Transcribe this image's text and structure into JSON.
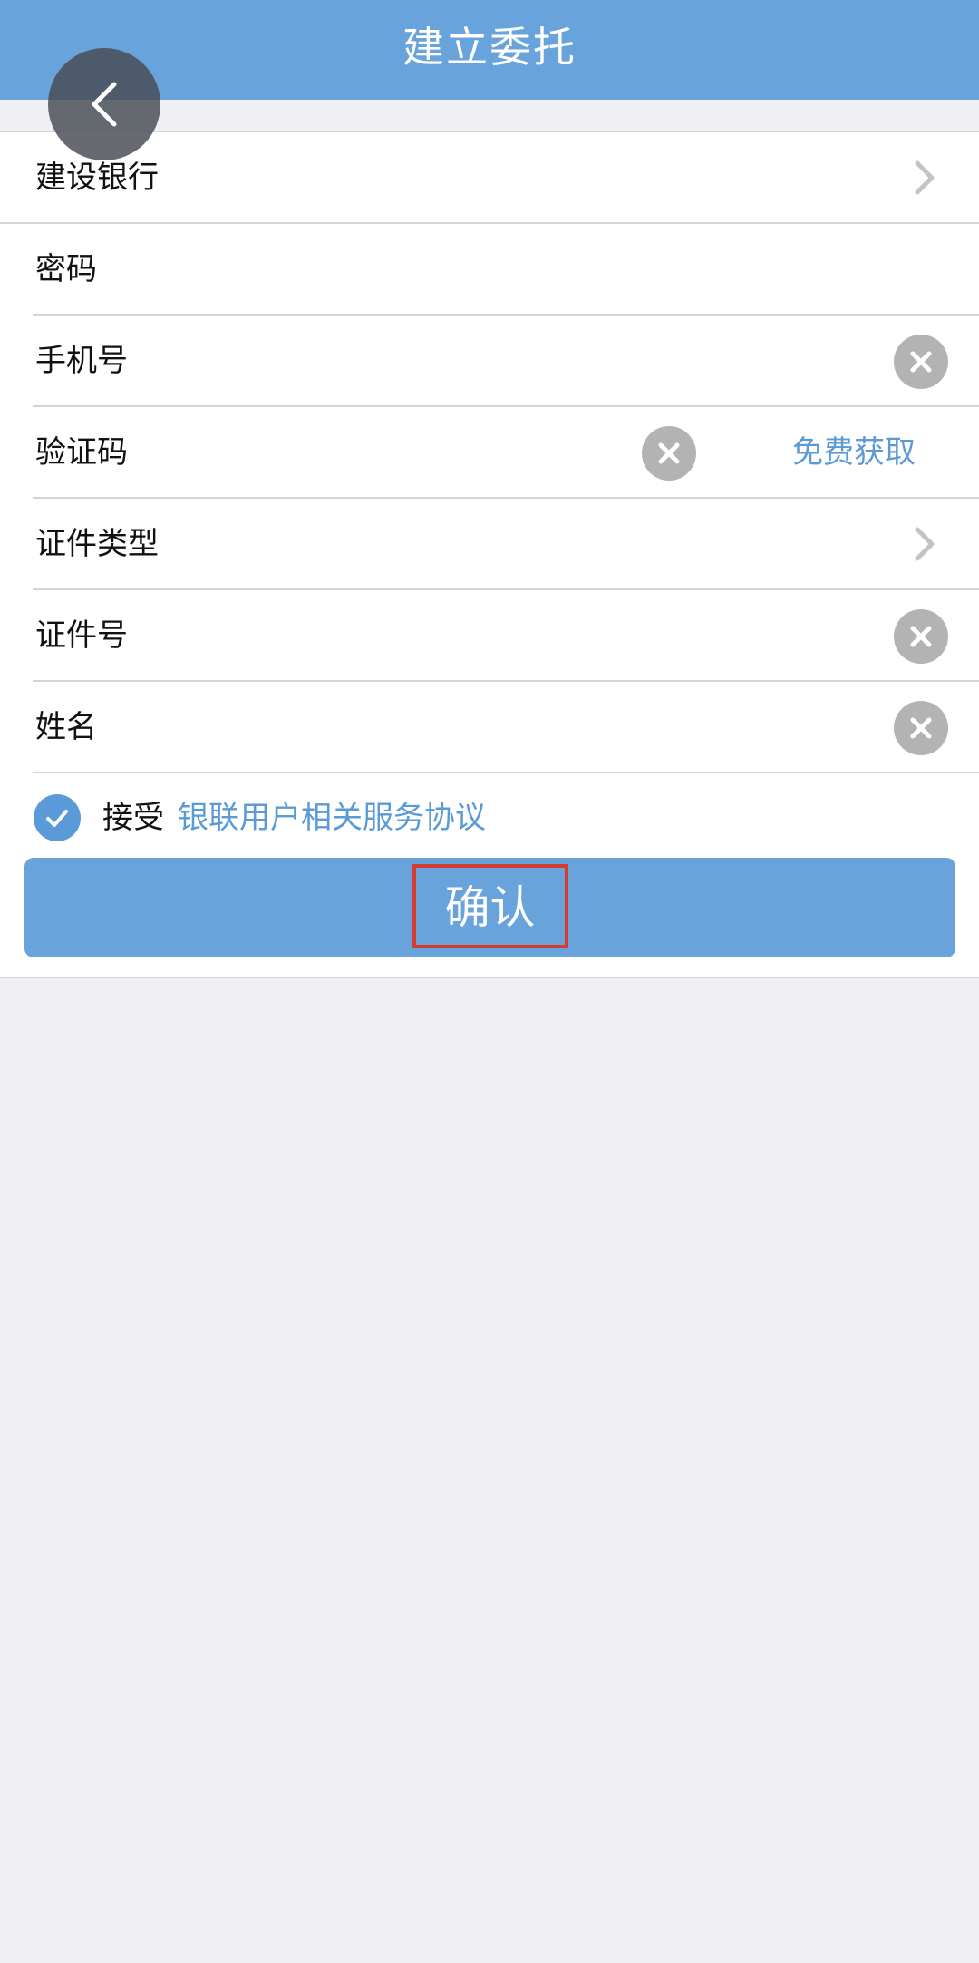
{
  "header": {
    "title": "建立委托",
    "back_icon": "chevron-left-icon"
  },
  "form": {
    "bank": {
      "value": "建设银行"
    },
    "password": {
      "label": "密码"
    },
    "phone": {
      "label": "手机号"
    },
    "verification": {
      "label": "验证码",
      "get_code_label": "免费获取"
    },
    "id_type": {
      "label": "证件类型"
    },
    "id_number": {
      "label": "证件号"
    },
    "name": {
      "label": "姓名"
    }
  },
  "agreement": {
    "checked": true,
    "prefix": "接受",
    "link_text": "银联用户相关服务协议"
  },
  "confirm_button": {
    "label": "确认"
  },
  "colors": {
    "header_bg": "#68a3dc",
    "accent": "#5b9bd5",
    "highlight": "#d63b2f",
    "clear_btn": "#b3b3b3",
    "page_bg": "#efeff4"
  }
}
